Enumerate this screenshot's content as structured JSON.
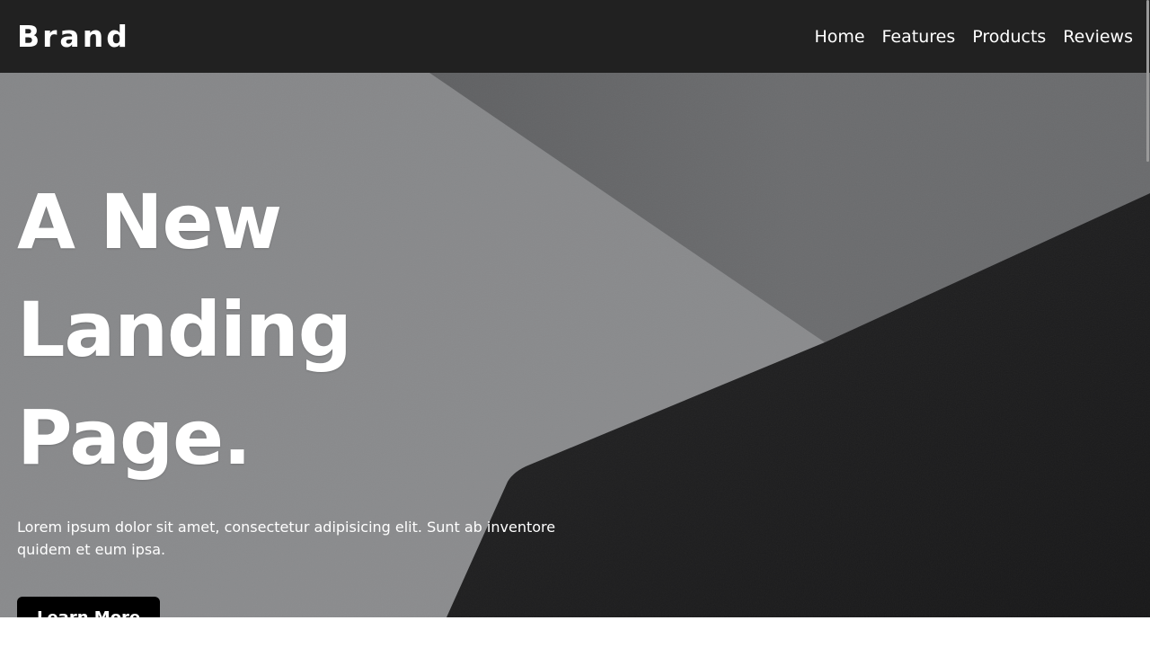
{
  "navbar": {
    "brand": "Brand",
    "links": [
      {
        "label": "Home"
      },
      {
        "label": "Features"
      },
      {
        "label": "Products"
      },
      {
        "label": "Reviews"
      }
    ]
  },
  "hero": {
    "title_line_1": "A New Landing",
    "title_line_2": "Page.",
    "description": "Lorem ipsum dolor sit amet, consectetur adipisicing elit. Sunt ab inventore quidem et eum ipsa.",
    "cta_label": "Learn More"
  },
  "colors": {
    "navbar_bg": "#212121",
    "text": "#ffffff",
    "button_bg": "#000000",
    "hero_wall_light": "#8a8b8d",
    "hero_wall_shadow": "#6a6b6d",
    "hero_dark_shape": "#1b1b1c"
  }
}
